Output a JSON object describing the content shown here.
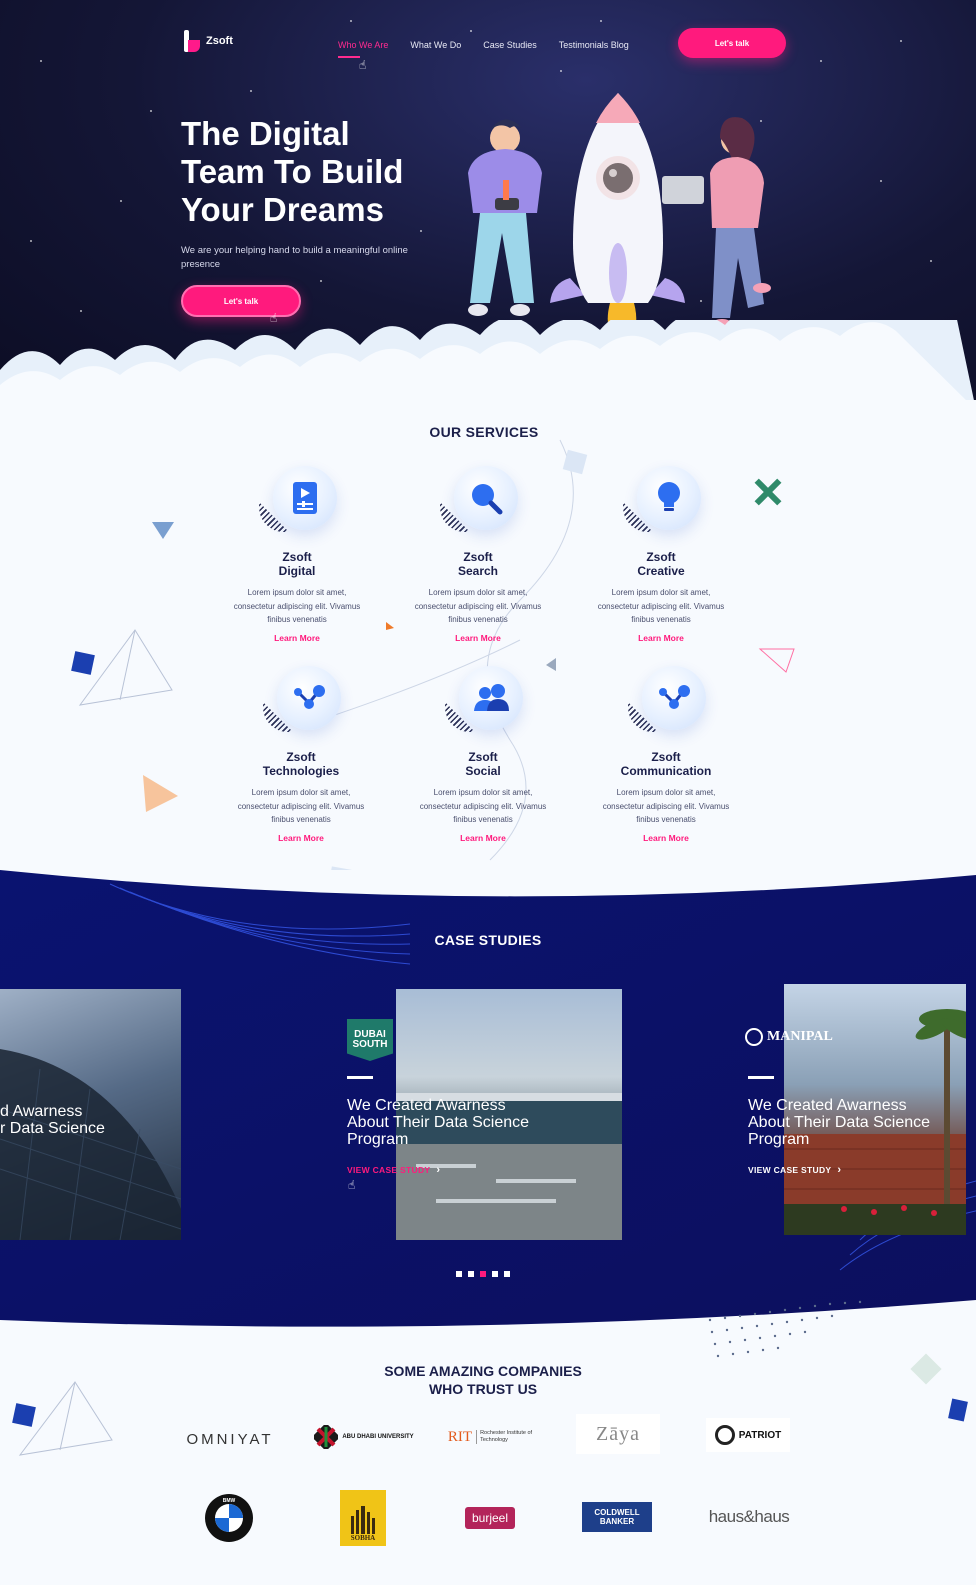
{
  "brand": {
    "name": "Zsoft"
  },
  "nav": {
    "items": [
      "Who We Are",
      "What We Do",
      "Case Studies",
      "Testimonials Blog"
    ],
    "cta": "Let's talk"
  },
  "hero": {
    "title_line1": "The Digital",
    "title_line2": "Team To Build",
    "title_line3": "Your Dreams",
    "subtitle": "We are your helping hand to build a meaningful online presence",
    "cta": "Let's talk"
  },
  "services": {
    "title": "OUR SERVICES",
    "items": [
      {
        "name": "Zsoft\nDigital",
        "desc": "Lorem ipsum dolor sit amet, consectetur adipiscing elit. Vivamus finibus venenatis",
        "link": "Learn More",
        "icon": "mobile-video-icon"
      },
      {
        "name": "Zsoft\nSearch",
        "desc": "Lorem ipsum dolor sit amet, consectetur adipiscing elit. Vivamus finibus venenatis",
        "link": "Learn More",
        "icon": "magnifier-icon"
      },
      {
        "name": "Zsoft\nCreative",
        "desc": "Lorem ipsum dolor sit amet, consectetur adipiscing elit. Vivamus finibus venenatis",
        "link": "Learn More",
        "icon": "lightbulb-icon"
      },
      {
        "name": "Zsoft\nTechnologies",
        "desc": "Lorem ipsum dolor sit amet, consectetur adipiscing elit. Vivamus finibus venenatis",
        "link": "Learn More",
        "icon": "network-nodes-icon"
      },
      {
        "name": "Zsoft\nSocial",
        "desc": "Lorem ipsum dolor sit amet, consectetur adipiscing elit. Vivamus finibus venenatis",
        "link": "Learn More",
        "icon": "users-icon"
      },
      {
        "name": "Zsoft\nCommunication",
        "desc": "Lorem ipsum dolor sit amet, consectetur adipiscing elit. Vivamus finibus venenatis",
        "link": "Learn More",
        "icon": "network-nodes-icon"
      }
    ]
  },
  "cases": {
    "title": "CASE STUDIES",
    "left_partial": "d Awarness\nr Data Science",
    "items": [
      {
        "logo_line1": "DUBAI",
        "logo_line2": "SOUTH",
        "title": "We Created Awarness\nAbout Their Data Science\nProgram",
        "link": "VIEW CASE STUDY"
      },
      {
        "logo_text": "MANIPAL",
        "title": "We Created Awarness\nAbout Their Data Science\nProgram",
        "link": "VIEW CASE STUDY"
      }
    ],
    "pagination_count": 5,
    "active_dot": 2
  },
  "companies": {
    "title": "SOME AMAZING COMPANIES\nWHO TRUST US",
    "logos": {
      "omniyat": "OMNIYAT",
      "adu_en": "ABU DHABI UNIVERSITY",
      "rit_short": "RIT",
      "rit_full": "Rochester Institute of Technology",
      "zaya": "Zāya",
      "patriot": "PATRIOT",
      "bmw": "BMW",
      "sobha": "SOBHA",
      "burjeel": "burjeel",
      "coldwell_line1": "COLDWELL",
      "coldwell_line2": "BANKER",
      "haus": "haus&haus"
    }
  },
  "colors": {
    "accent": "#ff1a7d",
    "navy": "#0d1673",
    "hero_bg": "#141636",
    "text": "#1b1f4a"
  }
}
